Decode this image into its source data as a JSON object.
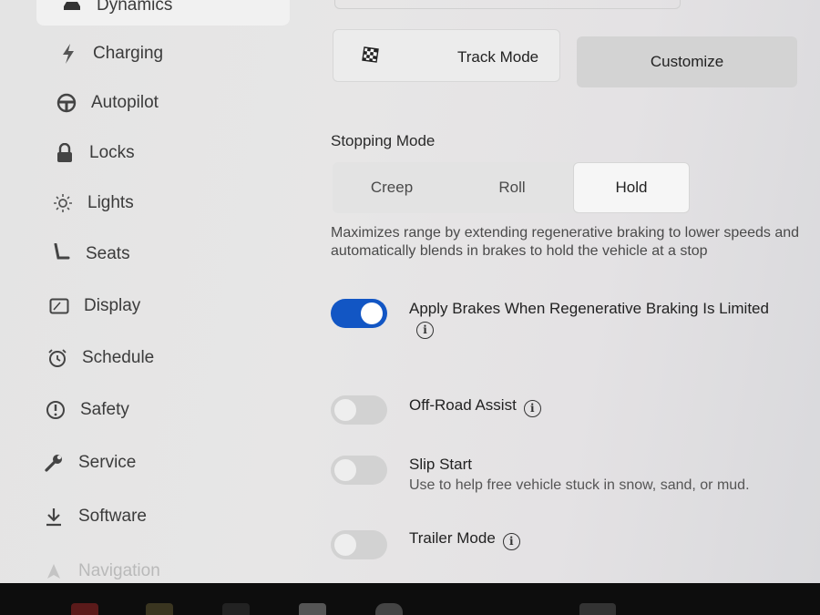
{
  "sidebar": {
    "items": [
      {
        "label": "Dynamics",
        "icon": "car-icon"
      },
      {
        "label": "Charging",
        "icon": "bolt-icon"
      },
      {
        "label": "Autopilot",
        "icon": "steering-wheel-icon"
      },
      {
        "label": "Locks",
        "icon": "lock-icon"
      },
      {
        "label": "Lights",
        "icon": "sun-icon"
      },
      {
        "label": "Seats",
        "icon": "seat-icon"
      },
      {
        "label": "Display",
        "icon": "display-icon"
      },
      {
        "label": "Schedule",
        "icon": "alarm-clock-icon"
      },
      {
        "label": "Safety",
        "icon": "alert-circle-icon"
      },
      {
        "label": "Service",
        "icon": "wrench-icon"
      },
      {
        "label": "Software",
        "icon": "download-icon"
      },
      {
        "label": "Navigation",
        "icon": "navigation-arrow-icon"
      }
    ]
  },
  "modes": {
    "track_label": "Track Mode",
    "customize_label": "Customize"
  },
  "stopping": {
    "title": "Stopping Mode",
    "options": [
      "Creep",
      "Roll",
      "Hold"
    ],
    "selected": "Hold",
    "description": "Maximizes range by extending regenerative braking to lower speeds and automatically blends in brakes to hold the vehicle at a stop"
  },
  "settings": [
    {
      "label": "Apply Brakes When Regenerative Braking Is Limited",
      "on": true,
      "info": true
    },
    {
      "label": "Off-Road Assist",
      "on": false,
      "info": true
    },
    {
      "label": "Slip Start",
      "sub": "Use to help free vehicle stuck in snow, sand, or mud.",
      "on": false,
      "info": false
    },
    {
      "label": "Trailer Mode",
      "on": false,
      "info": true
    }
  ],
  "colors": {
    "toggle_on": "#1256c4",
    "toggle_off": "#d2d2d2",
    "selected_segment": "#f6f6f6"
  }
}
